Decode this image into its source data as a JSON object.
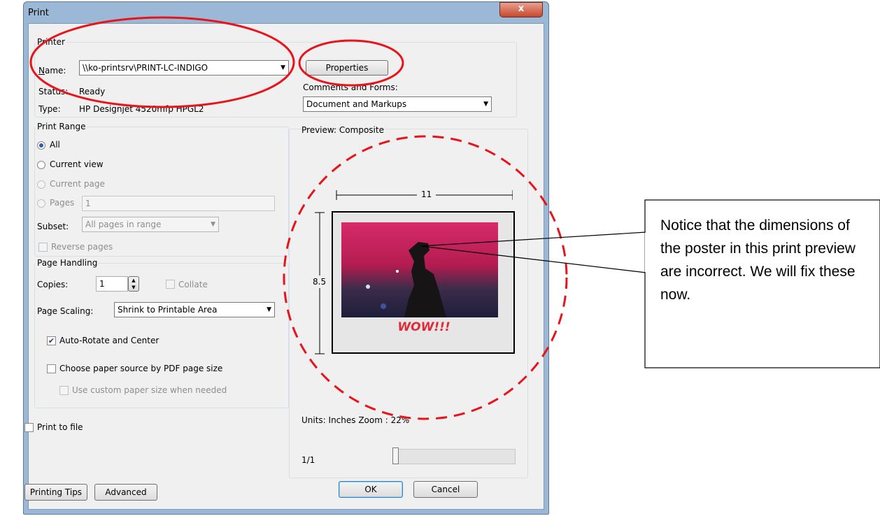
{
  "window": {
    "title": "Print",
    "close": "x"
  },
  "printer": {
    "group": "Printer",
    "name_label": "Name:",
    "name_value": "\\\\ko-printsrv\\PRINT-LC-INDIGO",
    "status_label": "Status:",
    "status_value": "Ready",
    "type_label": "Type:",
    "type_value": "HP Designjet 4520mfp HPGL2",
    "properties": "Properties",
    "comments_label": "Comments and Forms:",
    "comments_value": "Document and Markups"
  },
  "range": {
    "group": "Print Range",
    "all": "All",
    "current_view": "Current view",
    "current_page": "Current page",
    "pages": "Pages",
    "pages_value": "1",
    "subset_label": "Subset:",
    "subset_value": "All pages in range",
    "reverse": "Reverse pages"
  },
  "handling": {
    "group": "Page Handling",
    "copies_label": "Copies:",
    "copies_value": "1",
    "collate": "Collate",
    "scaling_label": "Page Scaling:",
    "scaling_value": "Shrink to Printable Area",
    "auto_rotate": "Auto-Rotate and Center",
    "paper_source": "Choose paper source by PDF page size",
    "custom_paper": "Use custom paper size when needed"
  },
  "print_to_file": "Print to file",
  "preview": {
    "label": "Preview: Composite",
    "width_dim": "11",
    "height_dim": "8.5",
    "wow": "WOW!!!",
    "units": "Units: Inches Zoom :  22%",
    "page": "1/1"
  },
  "buttons": {
    "tips": "Printing Tips",
    "advanced": "Advanced",
    "ok": "OK",
    "cancel": "Cancel"
  },
  "callout": {
    "text": "Notice that the dimensions of the poster in this print preview are incorrect. We will fix these now."
  },
  "colors": {
    "annotation": "#e8141c",
    "window_frame": "#9bb8d6",
    "dialog_bg": "#f0f0f0"
  }
}
